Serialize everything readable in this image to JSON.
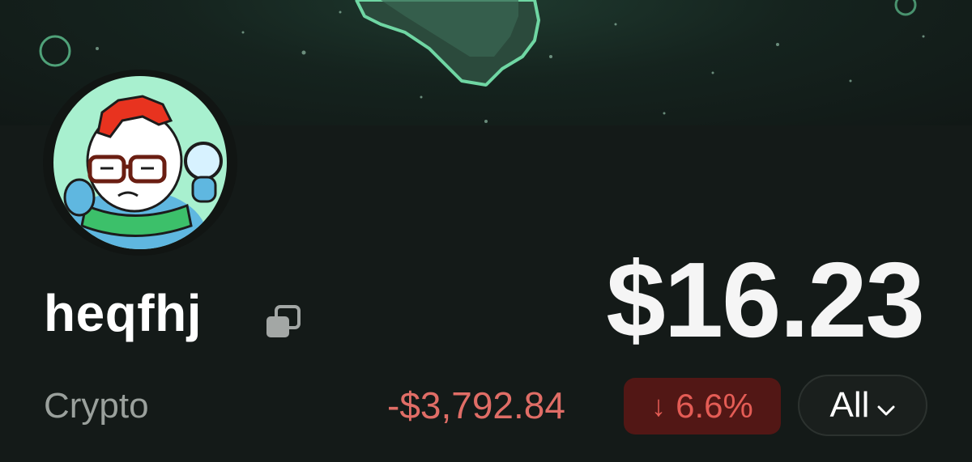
{
  "profile": {
    "username": "heqfhj",
    "category": "Crypto",
    "avatar_icon": "cartoon-egg-character-avatar",
    "copy_icon": "copy-icon"
  },
  "portfolio": {
    "balance": "$16.23",
    "change_amount": "-$3,792.84",
    "change_percent": "6.6%",
    "change_direction_icon": "arrow-down-icon",
    "range_label": "All",
    "range_icon": "chevron-down-icon"
  },
  "colors": {
    "background": "#141a18",
    "negative_text": "#e06d66",
    "negative_badge_bg": "#521715",
    "banner_accent": "#5fc391"
  }
}
